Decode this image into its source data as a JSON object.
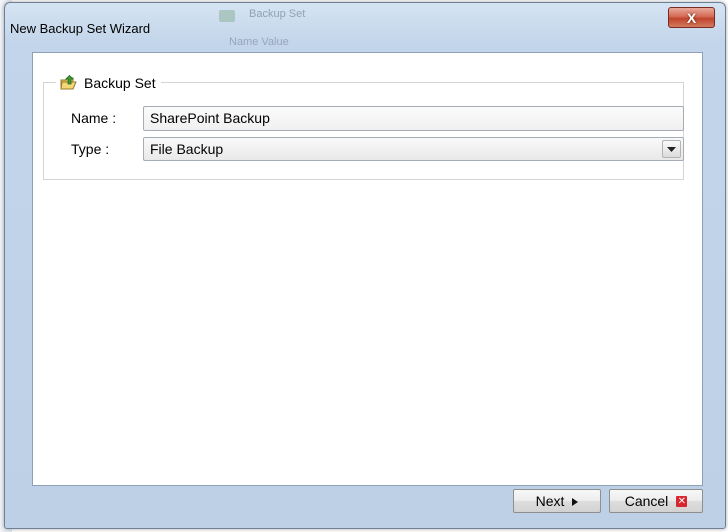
{
  "window": {
    "title": "New Backup Set Wizard",
    "background_app_text": "Backup Set",
    "background_app_text2": "Name     Value",
    "close_glyph": "X"
  },
  "backup_set": {
    "group_title": "Backup Set",
    "name_label": "Name :",
    "name_value": "SharePoint Backup",
    "type_label": "Type :",
    "type_value": "File Backup"
  },
  "buttons": {
    "next_label": "Next",
    "cancel_label": "Cancel"
  },
  "colors": {
    "title_bar": "#c3d5ea",
    "close_button": "#c0442c",
    "cancel_icon": "#d7262e"
  },
  "icons": {
    "group_icon": "folder-arrow-icon",
    "next_icon": "triangle-right-icon",
    "cancel_icon": "red-x-icon",
    "dropdown_icon": "chevron-down-icon"
  }
}
